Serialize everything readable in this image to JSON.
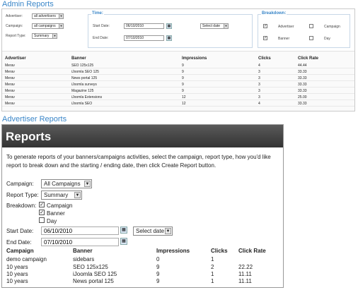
{
  "admin": {
    "title": "Admin Reports",
    "filters": {
      "advertiser_label": "Advertiser:",
      "advertiser_value": "all advertisers",
      "campaign_label": "Campaign:",
      "campaign_value": "all campaigns",
      "report_type_label": "Report Type:",
      "report_type_value": "Summary"
    },
    "time": {
      "legend": "Time:",
      "start_label": "Start Date:",
      "start_value": "06/10/2010",
      "end_label": "End Date:",
      "end_value": "07/10/2010",
      "select_date": "Select date"
    },
    "breakdown": {
      "legend": "Breakdown:",
      "items": [
        {
          "label": "Advertiser",
          "checked": true
        },
        {
          "label": "Campaign",
          "checked": false
        },
        {
          "label": "Banner",
          "checked": true
        },
        {
          "label": "Day",
          "checked": false
        }
      ]
    },
    "columns": [
      "Advertiser",
      "Banner",
      "Impressions",
      "Clicks",
      "Click Rate"
    ],
    "rows": [
      [
        "Merav",
        "SEO 125x125",
        "9",
        "4",
        "44.44"
      ],
      [
        "Merav",
        "iJoomla SEO 125",
        "9",
        "3",
        "33.33"
      ],
      [
        "Merav",
        "News portal 125",
        "9",
        "3",
        "33.33"
      ],
      [
        "Merav",
        "iJoomla surveys",
        "9",
        "3",
        "33.33"
      ],
      [
        "Merav",
        "Magazine 125",
        "9",
        "3",
        "33.33"
      ],
      [
        "Merav",
        "iJoomla Extensions",
        "12",
        "3",
        "25.00"
      ],
      [
        "Merav",
        "iJoomla SEO",
        "12",
        "4",
        "33.33"
      ]
    ]
  },
  "advertiser": {
    "title": "Advertiser Reports",
    "heading": "Reports",
    "intro": "To generate reports of your banners/campaigns activities, select the campaign, report type, how you'd like report to break down and the starting / ending date, then click Create Report button.",
    "campaign_label": "Campaign:",
    "campaign_value": "All Campaigns",
    "report_type_label": "Report Type:",
    "report_type_value": "Summary",
    "breakdown_label": "Breakdown:",
    "breakdown": [
      {
        "label": "Campaign",
        "checked": true
      },
      {
        "label": "Banner",
        "checked": true
      },
      {
        "label": "Day",
        "checked": false
      }
    ],
    "start_label": "Start Date:",
    "start_value": "06/10/2010",
    "end_label": "End Date:",
    "end_value": "07/10/2010",
    "select_date": "Select date",
    "columns": [
      "Campaign",
      "Banner",
      "Impressions",
      "Clicks",
      "Click Rate"
    ],
    "rows": [
      [
        "demo campaign",
        "sidebars",
        "0",
        "1",
        ""
      ],
      [
        "10 years",
        "SEO 125x125",
        "9",
        "2",
        "22.22"
      ],
      [
        "10 years",
        "iJoomla SEO 125",
        "9",
        "1",
        "11.11"
      ],
      [
        "10 years",
        "News portal 125",
        "9",
        "1",
        "11.11"
      ]
    ]
  }
}
